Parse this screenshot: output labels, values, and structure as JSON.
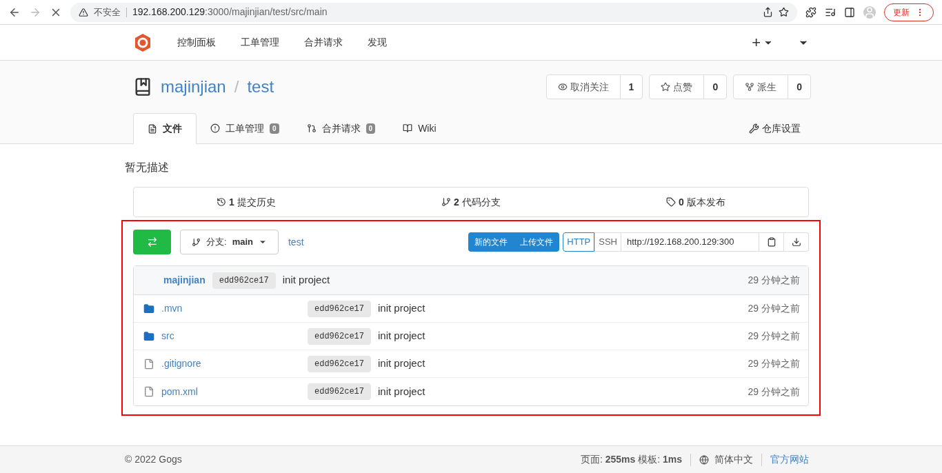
{
  "browser": {
    "security": "不安全",
    "url_host": "192.168.200.129",
    "url_path": ":3000/majinjian/test/src/main",
    "update_button": "更新"
  },
  "nav": {
    "items": [
      {
        "label": "控制面板"
      },
      {
        "label": "工单管理"
      },
      {
        "label": "合并请求"
      },
      {
        "label": "发现"
      }
    ],
    "plus": "+"
  },
  "repo": {
    "owner": "majinjian",
    "separator": "/",
    "name": "test",
    "actions": [
      {
        "kind": "watch",
        "label": "取消关注",
        "count": "1"
      },
      {
        "kind": "star",
        "label": "点赞",
        "count": "0"
      },
      {
        "kind": "fork",
        "label": "派生",
        "count": "0"
      }
    ],
    "tabs": [
      {
        "kind": "file",
        "label": "文件",
        "selected": true
      },
      {
        "kind": "issue",
        "label": "工单管理",
        "count": "0",
        "selected": false
      },
      {
        "kind": "pr",
        "label": "合并请求",
        "count": "0",
        "selected": false
      },
      {
        "kind": "wiki",
        "label": "Wiki",
        "selected": false
      }
    ],
    "settings": "仓库设置",
    "description": "暂无描述",
    "stats": [
      {
        "kind": "history",
        "count": "1",
        "label": "提交历史"
      },
      {
        "kind": "branch",
        "count": "2",
        "label": "代码分支"
      },
      {
        "kind": "tag",
        "count": "0",
        "label": "版本发布"
      }
    ]
  },
  "toolbar": {
    "branch_label": "分支:",
    "branch": "main",
    "path": "test",
    "new_file": "新的文件",
    "upload": "上传文件",
    "protocols": [
      {
        "label": "HTTP",
        "selected": true
      },
      {
        "label": "SSH",
        "selected": false
      }
    ],
    "clone_url": "http://192.168.200.129:300"
  },
  "commit": {
    "author": "majinjian",
    "sha": "edd962ce17",
    "message": "init project",
    "time": "29 分钟之前"
  },
  "files": [
    {
      "kind": "folder",
      "name": ".mvn",
      "sha": "edd962ce17",
      "message": "init project",
      "time": "29 分钟之前"
    },
    {
      "kind": "folder",
      "name": "src",
      "sha": "edd962ce17",
      "message": "init project",
      "time": "29 分钟之前"
    },
    {
      "kind": "file",
      "name": ".gitignore",
      "sha": "edd962ce17",
      "message": "init project",
      "time": "29 分钟之前"
    },
    {
      "kind": "file",
      "name": "pom.xml",
      "sha": "edd962ce17",
      "message": "init project",
      "time": "29 分钟之前"
    }
  ],
  "footer": {
    "copyright": "© 2022 Gogs",
    "page_label": "页面:",
    "page_time": "255ms",
    "template_label": "模板:",
    "template_time": "1ms",
    "language": "简体中文",
    "website": "官方网站"
  }
}
